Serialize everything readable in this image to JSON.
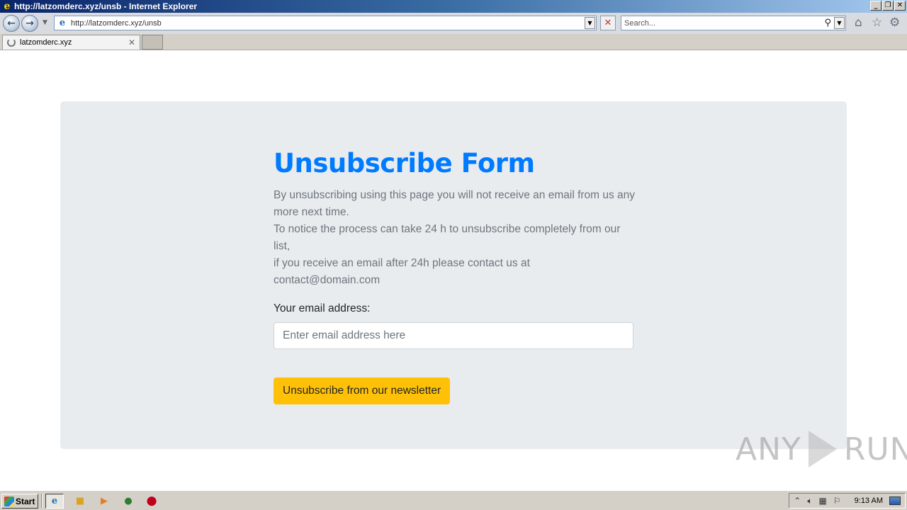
{
  "window": {
    "title": "http://latzomderc.xyz/unsb - Internet Explorer",
    "minimize": "_",
    "restore": "❐",
    "close": "✕"
  },
  "navbar": {
    "back_glyph": "←",
    "forward_glyph": "→",
    "address": "http://latzomderc.xyz/unsb",
    "search_placeholder": "Search...",
    "home_icon": "⌂",
    "favorites_icon": "☆",
    "tools_icon": "⚙"
  },
  "tabs": [
    {
      "label": "latzomderc.xyz",
      "loading": true
    }
  ],
  "page": {
    "heading": "Unsubscribe Form",
    "description_lines": [
      "By unsubscribing using this page you will not receive an email from us any more next time.",
      "To notice the process can take 24 h to unsubscribe completely from our list,",
      "if you receive an email after 24h please contact us at contact@domain.com"
    ],
    "email_label": "Your email address:",
    "email_placeholder": "Enter email address here",
    "submit_label": "Unsubscribe from our newsletter",
    "colors": {
      "heading": "#007bff",
      "panel": "#e9ecef",
      "button": "#ffc107",
      "text_muted": "#6c757d"
    }
  },
  "watermark": {
    "left": "ANY",
    "right": "RUN"
  },
  "taskbar": {
    "start_label": "Start",
    "clock": "9:13 AM"
  }
}
